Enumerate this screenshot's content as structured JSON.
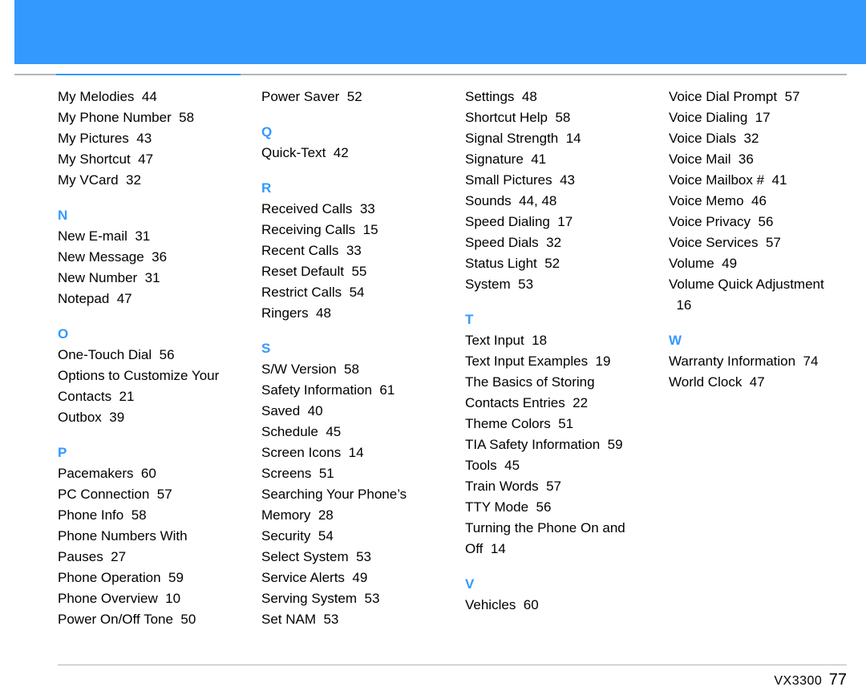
{
  "footer": {
    "model": "VX3300",
    "page": "77"
  },
  "sections": [
    {
      "first": true,
      "entries": [
        {
          "label": "My Melodies",
          "pages": "44"
        },
        {
          "label": "My Phone Number",
          "pages": "58"
        },
        {
          "label": "My Pictures",
          "pages": "43"
        },
        {
          "label": "My Shortcut",
          "pages": "47"
        },
        {
          "label": "My VCard",
          "pages": "32"
        }
      ]
    },
    {
      "letter": "N",
      "entries": [
        {
          "label": "New E-mail",
          "pages": "31"
        },
        {
          "label": "New Message",
          "pages": "36"
        },
        {
          "label": "New Number",
          "pages": "31"
        },
        {
          "label": "Notepad",
          "pages": "47"
        }
      ]
    },
    {
      "letter": "O",
      "entries": [
        {
          "label": "One-Touch Dial",
          "pages": "56"
        },
        {
          "label": "Options to Customize Your Contacts",
          "pages": "21"
        },
        {
          "label": "Outbox",
          "pages": "39"
        }
      ]
    },
    {
      "letter": "P",
      "entries": [
        {
          "label": "Pacemakers",
          "pages": "60"
        },
        {
          "label": "PC Connection",
          "pages": "57"
        },
        {
          "label": "Phone Info",
          "pages": "58"
        },
        {
          "label": "Phone Numbers With Pauses",
          "pages": "27"
        },
        {
          "label": "Phone Operation",
          "pages": "59"
        },
        {
          "label": "Phone Overview",
          "pages": "10"
        },
        {
          "label": "Power On/Off Tone",
          "pages": "50"
        },
        {
          "label": "Power Saver",
          "pages": "52"
        }
      ]
    },
    {
      "letter": "Q",
      "entries": [
        {
          "label": "Quick-Text",
          "pages": "42"
        }
      ]
    },
    {
      "letter": "R",
      "entries": [
        {
          "label": "Received Calls",
          "pages": "33"
        },
        {
          "label": "Receiving Calls",
          "pages": "15"
        },
        {
          "label": "Recent Calls",
          "pages": "33"
        },
        {
          "label": "Reset Default",
          "pages": "55"
        },
        {
          "label": "Restrict Calls",
          "pages": "54"
        },
        {
          "label": "Ringers",
          "pages": "48"
        }
      ]
    },
    {
      "letter": "S",
      "entries": [
        {
          "label": "S/W Version",
          "pages": "58"
        },
        {
          "label": "Safety Information",
          "pages": "61"
        },
        {
          "label": "Saved",
          "pages": "40"
        },
        {
          "label": "Schedule",
          "pages": "45"
        },
        {
          "label": "Screen Icons",
          "pages": "14"
        },
        {
          "label": "Screens",
          "pages": "51"
        },
        {
          "label": "Searching Your Phone’s Memory",
          "pages": "28"
        },
        {
          "label": "Security",
          "pages": "54"
        },
        {
          "label": "Select System",
          "pages": "53"
        },
        {
          "label": "Service Alerts",
          "pages": "49"
        },
        {
          "label": "Serving System",
          "pages": "53"
        },
        {
          "label": "Set NAM",
          "pages": "53"
        },
        {
          "label": "Settings",
          "pages": "48"
        },
        {
          "label": "Shortcut Help",
          "pages": "58"
        },
        {
          "label": "Signal Strength",
          "pages": "14"
        },
        {
          "label": "Signature",
          "pages": "41"
        },
        {
          "label": "Small Pictures",
          "pages": "43"
        },
        {
          "label": "Sounds",
          "pages": "44, 48"
        },
        {
          "label": "Speed Dialing",
          "pages": "17"
        },
        {
          "label": "Speed Dials",
          "pages": "32"
        },
        {
          "label": "Status Light",
          "pages": "52"
        },
        {
          "label": "System",
          "pages": "53"
        }
      ]
    },
    {
      "letter": "T",
      "entries": [
        {
          "label": "Text Input",
          "pages": "18"
        },
        {
          "label": "Text Input Examples",
          "pages": "19"
        },
        {
          "label": "The Basics of Storing Contacts Entries",
          "pages": "22"
        },
        {
          "label": "Theme Colors",
          "pages": "51"
        },
        {
          "label": "TIA Safety Information",
          "pages": "59"
        },
        {
          "label": "Tools",
          "pages": "45"
        },
        {
          "label": "Train Words",
          "pages": "57"
        },
        {
          "label": "TTY Mode",
          "pages": "56"
        },
        {
          "label": "Turning the Phone On and Off",
          "pages": "14"
        }
      ]
    },
    {
      "letter": "V",
      "entries": [
        {
          "label": "Vehicles",
          "pages": "60"
        },
        {
          "label": "Voice Dial Prompt",
          "pages": "57"
        },
        {
          "label": "Voice Dialing",
          "pages": "17"
        },
        {
          "label": "Voice Dials",
          "pages": "32"
        },
        {
          "label": "Voice Mail",
          "pages": "36"
        },
        {
          "label": "Voice Mailbox #",
          "pages": "41"
        },
        {
          "label": "Voice Memo",
          "pages": "46"
        },
        {
          "label": "Voice Privacy",
          "pages": "56"
        },
        {
          "label": "Voice Services",
          "pages": "57"
        },
        {
          "label": "Volume",
          "pages": "49"
        },
        {
          "label": "Volume Quick Adjustment",
          "pages": "16"
        }
      ]
    },
    {
      "letter": "W",
      "entries": [
        {
          "label": "Warranty Information",
          "pages": "74"
        },
        {
          "label": "World Clock",
          "pages": "47"
        }
      ]
    }
  ]
}
